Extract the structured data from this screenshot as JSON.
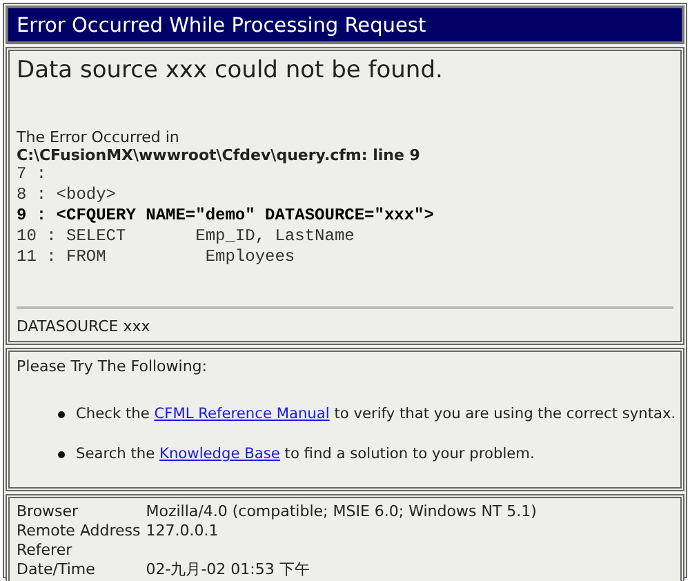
{
  "title": "Error Occurred While Processing Request",
  "error": {
    "message": "Data source xxx could not be found.",
    "location_label": "The Error Occurred in",
    "location": "C:\\CFusionMX\\wwwroot\\Cfdev\\query.cfm: line 9",
    "code_lines": [
      {
        "text": "7 :",
        "highlighted": false
      },
      {
        "text": "8 : <body>",
        "highlighted": false
      },
      {
        "text": "9 : <CFQUERY NAME=\"demo\" DATASOURCE=\"xxx\">",
        "highlighted": true
      },
      {
        "text": "10 : SELECT       Emp_ID, LastName",
        "highlighted": false
      },
      {
        "text": "11 : FROM          Employees",
        "highlighted": false
      }
    ],
    "detail": "DATASOURCE  xxx"
  },
  "suggestions": {
    "heading": "Please Try The Following:",
    "items": [
      {
        "before": "Check the",
        "link": "CFML Reference Manual",
        "after": "to verify that you are using the correct syntax."
      },
      {
        "before": "Search the",
        "link": "Knowledge Base",
        "after": "to find a solution to your problem."
      }
    ]
  },
  "request_info": [
    {
      "label": "Browser",
      "value": "Mozilla/4.0 (compatible; MSIE 6.0; Windows NT 5.1)"
    },
    {
      "label": "Remote Address",
      "value": "127.0.0.1"
    },
    {
      "label": "Referer"
    },
    {
      "label": "Date/Time",
      "value": "02-九月-02 01:53 下午"
    }
  ]
}
